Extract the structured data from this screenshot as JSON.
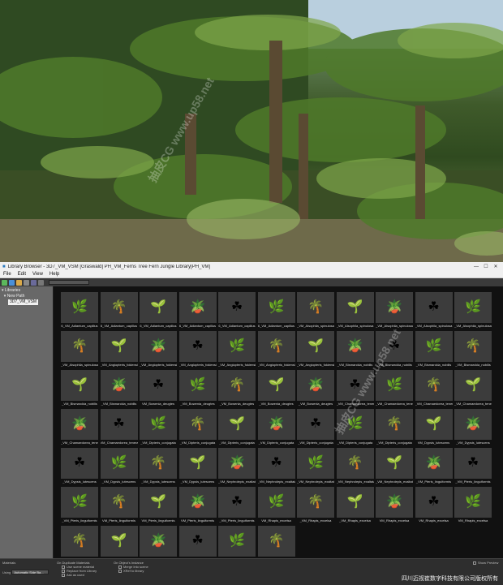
{
  "titlebar": {
    "title": "Library Browser - 3D7_VM_VSM [Graswald] PH_VM_Ferns Tree Fern Jungle Library[PH_VM]",
    "minimize": "—",
    "maximize": "☐",
    "close": "✕"
  },
  "menu": [
    "File",
    "Edit",
    "View",
    "Help"
  ],
  "toolbar": {
    "search_placeholder": ""
  },
  "tree": {
    "root": "Libraries",
    "child": "New Path",
    "selected": "3D7_VM_VSM"
  },
  "tiles": [
    "6_VM_Adiantum_capillus",
    "6_VM_Adiantum_capillus",
    "6_VM_Adiantum_capillus",
    "6_VM_Adiantum_capillus",
    "6_VM_Adiantum_capillus",
    "6_VM_Adiantum_capillus",
    "_VM_Alsophila_spinulosa",
    "_VM_Alsophila_spinulosa",
    "_VM_Alsophila_spinulosa",
    "_VM_Alsophila_spinulosa",
    "_VM_Alsophila_spinulosa",
    "_VM_Alsophila_spinulosa",
    "_VM_Angiopteris_fokiensi",
    "_VM_Angiopteris_fokiensi",
    "_VM_Angiopteris_fokiensi",
    "_VM_Angiopteris_fokiensi",
    "_VM_Angiopteris_fokiensi",
    "_VM_Angiopteris_fokiensi",
    "_VM_Bismarckia_nobilis",
    "_VM_Bismarckia_nobilis",
    "_VM_Bismarckia_nobilis",
    "_VM_Bismarckia_nobilis",
    "_VM_Bismarckia_nobilis",
    "_VM_Bismarckia_nobilis",
    "VM_Bowenia_deugtes",
    "_VM_Bowenia_deugtes",
    "_VM_Bowenia_deugtes",
    "_VM_Bowenia_deugtes",
    "_VM_Bowenia_deugtes",
    "_VM_Chamaedorea_tenera",
    "_VM_Chamaedorea_tenera",
    "_VM_Chamaedorea_tenera",
    "_VM_Chamaedorea_tenera",
    "_VM_Chamaedorea_tenera",
    "VM_Chamaedorea_tenera",
    "_VM_Dipteris_conjugata",
    "_VM_Dipteris_conjugata",
    "_VM_Dipteris_conjugata",
    "_VM_Dipteris_conjugata",
    "_VM_Dipteris_conjugata",
    "_VM_Dipteris_conjugata",
    "_VM_Dipteris_conjugata",
    "VM_Dypsis_lutescens",
    "_VM_Dypsis_lutescens",
    "_VM_Dypsis_lutescens",
    "_VM_Dypsis_lutescens",
    "_VM_Dypsis_lutescens",
    "_VM_Dypsis_lutescens",
    "_VM_Nephrolepis_exaltata",
    "_VM_Nephrolepis_exaltata",
    "_VM_Nephrolepis_exaltata",
    "_VM_Nephrolepis_exaltata",
    "_VM_Nephrolepis_exaltata",
    "_VM_Pteris_linguiformis",
    "_VM_Pteris_linguiformis",
    "_VM_Pteris_linguiformis",
    "VM_Pteris_linguiformis",
    "VM_Pteris_linguiformis",
    "VM_Pteris_linguiformis",
    "_VM_Pteris_linguiformis",
    "VM_Rhapis_excelsa",
    "_VM_Rhapis_excelsa",
    "_VM_Rhapis_excelsa",
    "VM_Rhapis_excelsa",
    "VM_Rhapis_excelsa",
    "VM_Rhapis_excelsa",
    "_VM_Sphaeropteris_lepifera",
    "VM_Sphaeropteris_lepifera",
    "_VM_Sphaeropteris_lepifera",
    "_VM_Sphaeropteris_lepifera",
    "_VM_Sphaeropteris_lepifera",
    "_VM_Sphaeropteris_lepifera"
  ],
  "bottom": {
    "materials_label": "Materials",
    "using_label": "Using",
    "using_value": "Automatic Side Ba...",
    "duplicate_label": "On Duplicate Materials",
    "dup_opts": [
      "Use scene material",
      "Replace from Library",
      "Ask as used"
    ],
    "instance_label": "On Object's Instance",
    "inst_opts": [
      "Merge into scene",
      "XRef to library"
    ],
    "preview_label": "Show Preview"
  },
  "copyright": "四川迈视崔数字科技有限公司版权所有",
  "watermark": "抽皮CG www.up58.net"
}
